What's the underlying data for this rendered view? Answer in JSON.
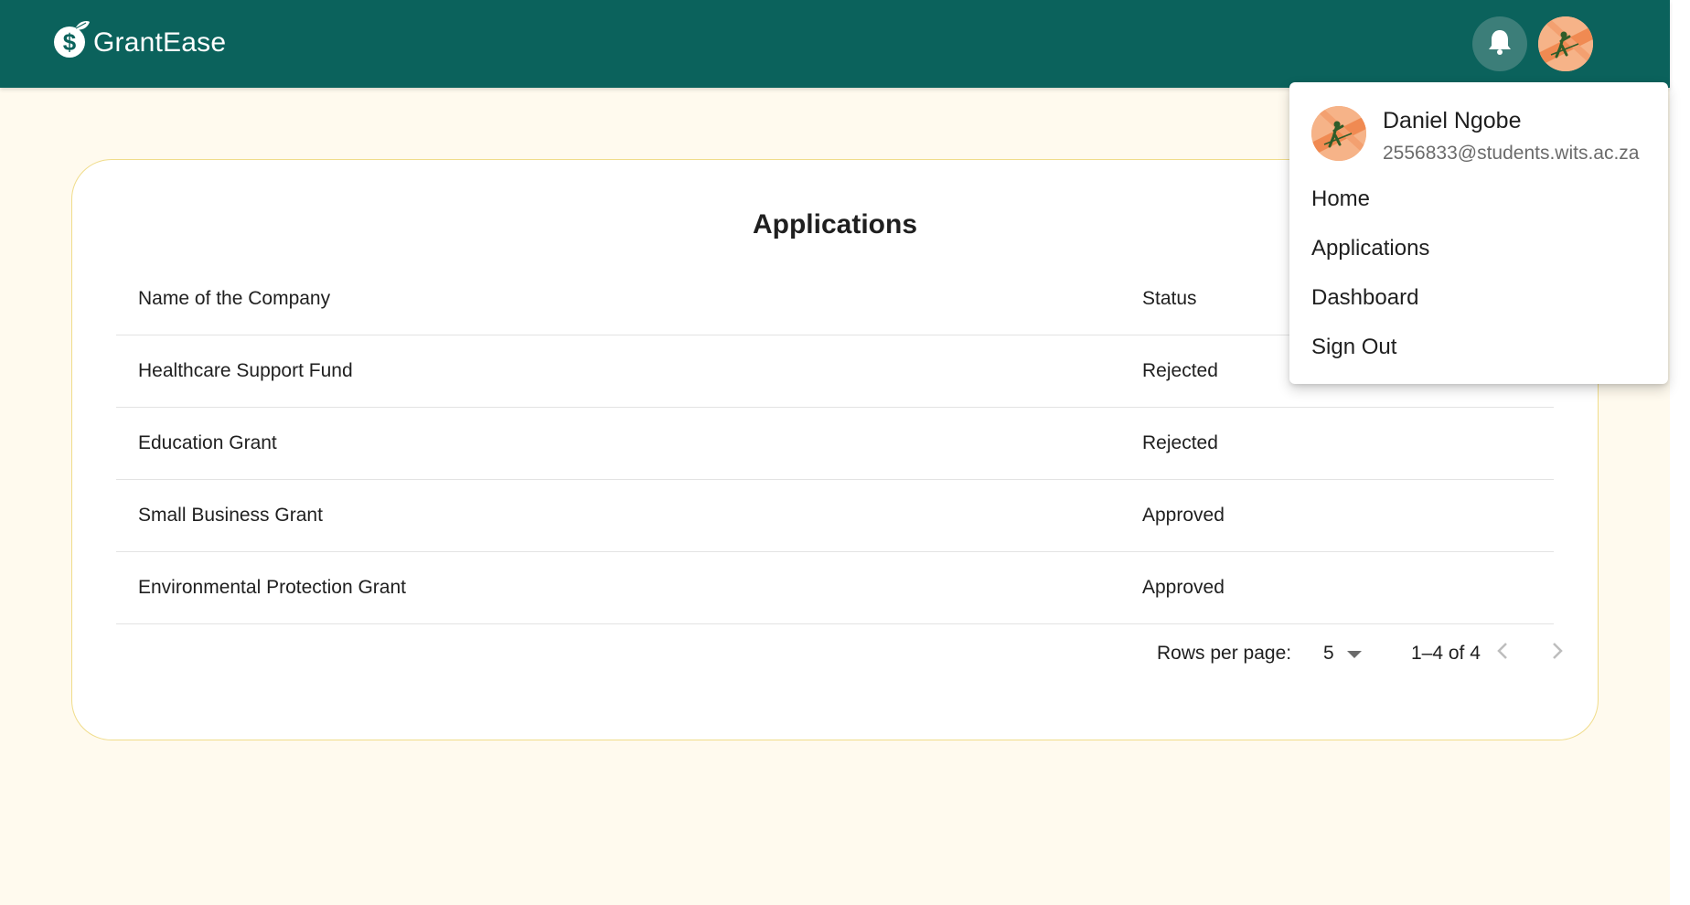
{
  "app": {
    "name": "GrantEase",
    "colors": {
      "appbar": "#0b625c",
      "page_background": "#fffaee",
      "card_border": "#f0dc8a",
      "avatar_accent": "#f6b388"
    },
    "icons": [
      "leaf-dollar-logo-icon",
      "bell-icon",
      "avatar-image",
      "chevron-left-icon",
      "chevron-right-icon",
      "dropdown-arrow-icon"
    ]
  },
  "applications": {
    "title": "Applications",
    "columns": [
      "Name of the Company",
      "Status"
    ],
    "rows": [
      {
        "name": "Healthcare Support Fund",
        "status": "Rejected"
      },
      {
        "name": "Education Grant",
        "status": "Rejected"
      },
      {
        "name": "Small Business Grant",
        "status": "Approved"
      },
      {
        "name": "Environmental Protection Grant",
        "status": "Approved"
      }
    ],
    "pagination": {
      "rows_per_page_label": "Rows per page:",
      "rows_per_page": "5",
      "range": "1–4 of 4"
    }
  },
  "user_menu": {
    "name": "Daniel Ngobe",
    "email": "2556833@students.wits.ac.za",
    "items": [
      "Home",
      "Applications",
      "Dashboard",
      "Sign Out"
    ]
  }
}
